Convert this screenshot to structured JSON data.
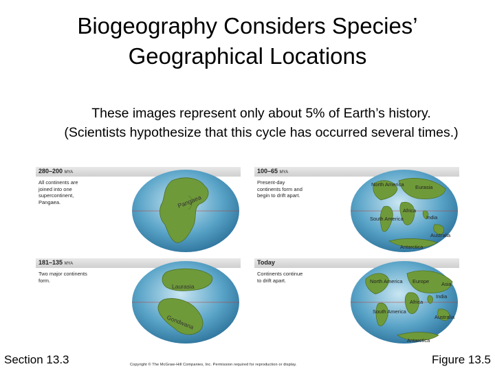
{
  "title_line1": "Biogeography Considers Species’",
  "title_line2": "Geographical Locations",
  "subtitle_line1": "These images represent only about 5% of Earth’s history.",
  "subtitle_line2": "(Scientists hypothesize that this cycle has occurred several times.)",
  "panels": [
    {
      "era": "280–200",
      "unit": "MYA",
      "desc": "All continents are joined into one supercontinent, Pangaea.",
      "labels": [
        "Pangaea"
      ]
    },
    {
      "era": "100–65",
      "unit": "MYA",
      "desc": "Present-day continents form and begin to drift apart.",
      "labels": [
        "North America",
        "Eurasia",
        "Africa",
        "South America",
        "India",
        "Australia",
        "Antarctica"
      ]
    },
    {
      "era": "181–135",
      "unit": "MYA",
      "desc": "Two major continents form.",
      "labels": [
        "Laurasia",
        "Gondwana"
      ]
    },
    {
      "era": "Today",
      "unit": "",
      "desc": "Continents continue to drift apart.",
      "labels": [
        "North America",
        "Europe",
        "Asia",
        "Africa",
        "India",
        "South America",
        "Australia",
        "Antarctica"
      ]
    }
  ],
  "footer_left": "Section 13.3",
  "footer_right": "Figure 13.5",
  "copyright": "Copyright © The McGraw-Hill Companies, Inc. Permission required for reproduction or display."
}
